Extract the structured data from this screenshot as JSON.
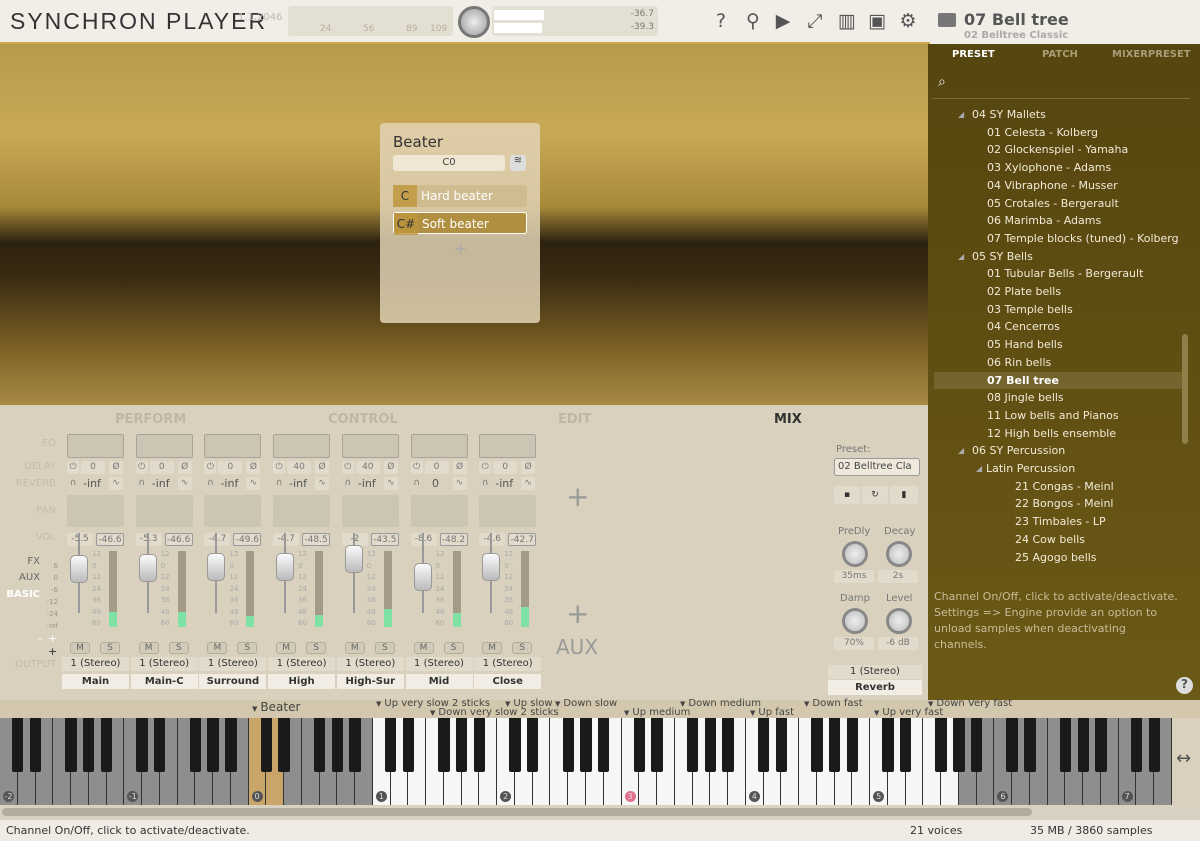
{
  "header": {
    "title": "SYNCHRON PLAYER",
    "version": "1.1.2046",
    "meter_ticks": [
      "24",
      "56",
      "89",
      "109"
    ],
    "level_left": "-36.7",
    "level_right": "-39.3",
    "icons": [
      "help-icon",
      "location-pin-icon",
      "play-icon",
      "resize-icon",
      "piano-icon",
      "cpu-icon",
      "gear-icon"
    ]
  },
  "instrument": {
    "title": "07 Bell tree",
    "preset": "02 Belltree Classic"
  },
  "beater": {
    "title": "Beater",
    "value": "C0",
    "articulations": [
      {
        "key": "C",
        "label": "Hard beater",
        "selected": false
      },
      {
        "key": "C#",
        "label": "Soft beater",
        "selected": true
      }
    ],
    "add": "+"
  },
  "tabs": [
    {
      "label": "PERFORM",
      "active": false
    },
    {
      "label": "CONTROL",
      "active": false
    },
    {
      "label": "EDIT",
      "active": false
    },
    {
      "label": "MIX",
      "active": true
    }
  ],
  "row_labels": {
    "eq": "EQ",
    "delay": "DELAY",
    "reverb": "REVERB",
    "pan": "PAN",
    "vol": "VOL",
    "fx": "FX",
    "aux": "AUX",
    "basic": "BASIC",
    "minus": "-",
    "plus": "+",
    "plus2": "+",
    "output": "OUTPUT"
  },
  "channels": [
    {
      "name": "Main",
      "delay": "0",
      "reverb": "-inf",
      "vol": "-5.5",
      "peak": "-46.6",
      "output": "1 (Stereo)",
      "fader": 0.55,
      "meter": 0.2
    },
    {
      "name": "Main-C",
      "delay": "0",
      "reverb": "-inf",
      "vol": "-5.3",
      "peak": "-46.6",
      "output": "1 (Stereo)",
      "fader": 0.56,
      "meter": 0.2
    },
    {
      "name": "Surround",
      "delay": "0",
      "reverb": "-inf",
      "vol": "-4.7",
      "peak": "-49.6",
      "output": "1 (Stereo)",
      "fader": 0.58,
      "meter": 0.15
    },
    {
      "name": "High",
      "delay": "40",
      "reverb": "-inf",
      "vol": "-4.7",
      "peak": "-48.5",
      "output": "1 (Stereo)",
      "fader": 0.58,
      "meter": 0.16
    },
    {
      "name": "High-Sur",
      "delay": "40",
      "reverb": "-inf",
      "vol": "-2",
      "peak": "-43.5",
      "output": "1 (Stereo)",
      "fader": 0.68,
      "meter": 0.24
    },
    {
      "name": "Mid",
      "delay": "0",
      "reverb": "0",
      "vol": "-8.6",
      "peak": "-48.2",
      "output": "1 (Stereo)",
      "fader": 0.45,
      "meter": 0.18
    },
    {
      "name": "Close",
      "delay": "0",
      "reverb": "-inf",
      "vol": "-4.6",
      "peak": "-42.7",
      "output": "1 (Stereo)",
      "fader": 0.58,
      "meter": 0.26
    }
  ],
  "meter_scale": [
    "12",
    "0",
    "12",
    "24",
    "36",
    "48",
    "60"
  ],
  "fader_scale": [
    "6",
    "0",
    "-6",
    "-12",
    "-24",
    "-inf"
  ],
  "mute_label": "M",
  "solo_label": "S",
  "fx_add": "+",
  "aux_add": "+",
  "aux_label": "AUX",
  "reverb": {
    "preset_label": "Preset:",
    "preset": "02 Belltree Cla",
    "knobs": [
      {
        "label": "PreDly",
        "value": "35ms"
      },
      {
        "label": "Decay",
        "value": "2s"
      },
      {
        "label": "Damp",
        "value": "70%"
      },
      {
        "label": "Level",
        "value": "-6 dB"
      }
    ],
    "output": "1 (Stereo)",
    "name": "Reverb"
  },
  "browser": {
    "tabs": [
      "PRESET",
      "PATCH",
      "MIXERPRESET"
    ],
    "active_tab": "PRESET",
    "tree": [
      {
        "label": "04 SY Mallets",
        "level": 1,
        "folder": true
      },
      {
        "label": "01 Celesta - Kolberg",
        "level": 2
      },
      {
        "label": "02 Glockenspiel - Yamaha",
        "level": 2
      },
      {
        "label": "03 Xylophone - Adams",
        "level": 2
      },
      {
        "label": "04 Vibraphone - Musser",
        "level": 2
      },
      {
        "label": "05 Crotales - Bergerault",
        "level": 2
      },
      {
        "label": "06 Marimba - Adams",
        "level": 2
      },
      {
        "label": "07 Temple blocks (tuned) - Kolberg",
        "level": 2
      },
      {
        "label": "05 SY Bells",
        "level": 1,
        "folder": true
      },
      {
        "label": "01 Tubular Bells - Bergerault",
        "level": 2
      },
      {
        "label": "02 Plate bells",
        "level": 2
      },
      {
        "label": "03 Temple bells",
        "level": 2
      },
      {
        "label": "04 Cencerros",
        "level": 2
      },
      {
        "label": "05 Hand bells",
        "level": 2
      },
      {
        "label": "06 Rin bells",
        "level": 2
      },
      {
        "label": "07 Bell tree",
        "level": 2,
        "selected": true
      },
      {
        "label": "08 Jingle bells",
        "level": 2
      },
      {
        "label": "11 Low bells and Pianos",
        "level": 2
      },
      {
        "label": "12 High bells ensemble",
        "level": 2
      },
      {
        "label": "06 SY Percussion",
        "level": 1,
        "folder": true
      },
      {
        "label": "Latin Percussion",
        "level": 2,
        "folder": true
      },
      {
        "label": "21 Congas - Meinl",
        "level": 3
      },
      {
        "label": "22 Bongos - Meinl",
        "level": 3
      },
      {
        "label": "23 Timbales - LP",
        "level": 3
      },
      {
        "label": "24 Cow bells",
        "level": 3
      },
      {
        "label": "25 Agogo bells",
        "level": 3
      }
    ],
    "help": "Channel On/Off, click to activate/deactivate. Settings => Engine provide an option to unload samples when deactivating channels.",
    "help_button": "?"
  },
  "keyswitch_labels": [
    {
      "label": "Beater",
      "big": true
    },
    {
      "label": "Up very slow 2 sticks"
    },
    {
      "label": "Down very slow 2 sticks"
    },
    {
      "label": "Up slow"
    },
    {
      "label": "Down slow"
    },
    {
      "label": "Up medium"
    },
    {
      "label": "Down medium"
    },
    {
      "label": "Up fast"
    },
    {
      "label": "Down fast"
    },
    {
      "label": "Up very fast"
    },
    {
      "label": "Down Very fast"
    }
  ],
  "octaves": [
    "-2",
    "-1",
    "0",
    "1",
    "2",
    "3",
    "4",
    "5",
    "6",
    "7"
  ],
  "status": {
    "message": "Channel On/Off, click to activate/deactivate.",
    "voices": "21 voices",
    "memory": "35 MB / 3860 samples"
  },
  "colors": {
    "accent": "#c9a84a",
    "panel": "#5e4d12",
    "meter": "#7fe1a3"
  }
}
